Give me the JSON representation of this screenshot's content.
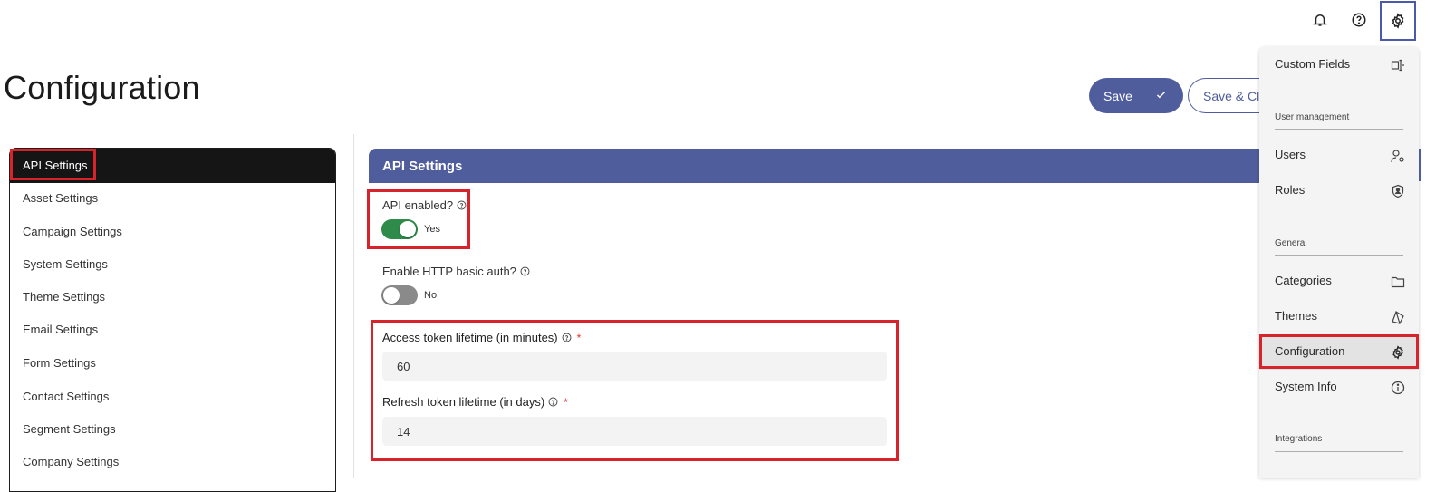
{
  "header": {
    "notifications_icon": "bell-icon",
    "help_icon": "help-circle-icon",
    "settings_icon": "gear-icon"
  },
  "page": {
    "title": "Configuration"
  },
  "actions": {
    "save_label": "Save",
    "save_close_label": "Save & Close"
  },
  "sidebar": {
    "items": [
      {
        "label": "API Settings",
        "active": true
      },
      {
        "label": "Asset Settings"
      },
      {
        "label": "Campaign Settings"
      },
      {
        "label": "System Settings"
      },
      {
        "label": "Theme Settings"
      },
      {
        "label": "Email Settings"
      },
      {
        "label": "Form Settings"
      },
      {
        "label": "Contact Settings"
      },
      {
        "label": "Segment Settings"
      },
      {
        "label": "Company Settings"
      }
    ]
  },
  "panel": {
    "title": "API Settings",
    "api_enabled": {
      "label": "API enabled?",
      "state": "Yes",
      "on": true
    },
    "http_basic_auth": {
      "label": "Enable HTTP basic auth?",
      "state": "No",
      "on": false
    },
    "access_token": {
      "label": "Access token lifetime (in minutes)",
      "required_mark": "*",
      "value": "60"
    },
    "refresh_token": {
      "label": "Refresh token lifetime (in days)",
      "required_mark": "*",
      "value": "14"
    }
  },
  "settings_menu": {
    "custom_fields": "Custom Fields",
    "user_management_heading": "User management",
    "users": "Users",
    "roles": "Roles",
    "general_heading": "General",
    "categories": "Categories",
    "themes": "Themes",
    "configuration": "Configuration",
    "system_info": "System Info",
    "integrations_heading": "Integrations"
  },
  "colors": {
    "accent": "#4f5d9d",
    "toggle_on": "#2e8b4a",
    "highlight_border": "#d8232a"
  }
}
